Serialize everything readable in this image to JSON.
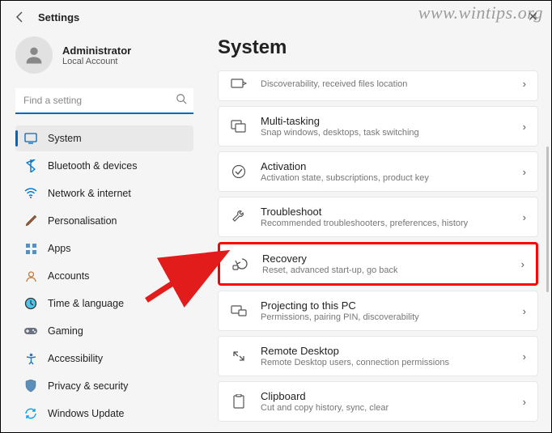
{
  "watermark": "www.wintips.org",
  "header": {
    "title": "Settings"
  },
  "user": {
    "name": "Administrator",
    "sub": "Local Account"
  },
  "search": {
    "placeholder": "Find a setting"
  },
  "nav": {
    "items": [
      {
        "label": "System"
      },
      {
        "label": "Bluetooth & devices"
      },
      {
        "label": "Network & internet"
      },
      {
        "label": "Personalisation"
      },
      {
        "label": "Apps"
      },
      {
        "label": "Accounts"
      },
      {
        "label": "Time & language"
      },
      {
        "label": "Gaming"
      },
      {
        "label": "Accessibility"
      },
      {
        "label": "Privacy & security"
      },
      {
        "label": "Windows Update"
      }
    ]
  },
  "main": {
    "title": "System",
    "cards": [
      {
        "title": "",
        "sub": "Discoverability, received files location"
      },
      {
        "title": "Multi-tasking",
        "sub": "Snap windows, desktops, task switching"
      },
      {
        "title": "Activation",
        "sub": "Activation state, subscriptions, product key"
      },
      {
        "title": "Troubleshoot",
        "sub": "Recommended troubleshooters, preferences, history"
      },
      {
        "title": "Recovery",
        "sub": "Reset, advanced start-up, go back"
      },
      {
        "title": "Projecting to this PC",
        "sub": "Permissions, pairing PIN, discoverability"
      },
      {
        "title": "Remote Desktop",
        "sub": "Remote Desktop users, connection permissions"
      },
      {
        "title": "Clipboard",
        "sub": "Cut and copy history, sync, clear"
      }
    ]
  }
}
